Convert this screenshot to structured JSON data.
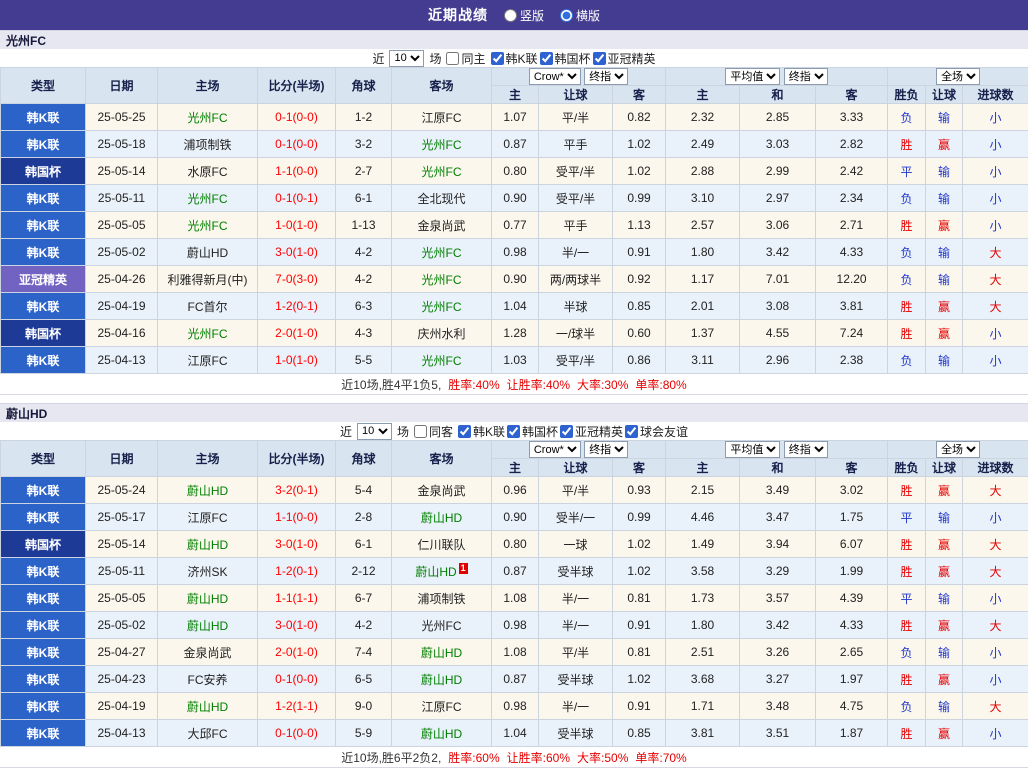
{
  "colors": {
    "red": "#e60000",
    "blue": "#2036cc",
    "green": "#008000",
    "score_red": "#ff0000",
    "topbar_bg": "#443c90",
    "kleague_bg": "#2c63c8",
    "cup_bg": "#1d3a96",
    "acl_bg": "#7263c2"
  },
  "topbar": {
    "title": "近期战绩",
    "layout_options": [
      {
        "label": "竖版",
        "selected": false
      },
      {
        "label": "横版",
        "selected": true
      }
    ]
  },
  "sections": [
    {
      "team": "光州FC",
      "filter": {
        "near_label": "近",
        "count": "10",
        "games_label": "场",
        "same_checkbox": {
          "label": "同主",
          "checked": false
        },
        "league_checkboxes": [
          {
            "label": "韩K联",
            "checked": true
          },
          {
            "label": "韩国杯",
            "checked": true
          },
          {
            "label": "亚冠精英",
            "checked": true
          }
        ]
      },
      "header": {
        "type": "类型",
        "date": "日期",
        "home": "主场",
        "score": "比分(半场)",
        "corner": "角球",
        "away": "客场",
        "odds_select": "Crow*",
        "odds_time_select": "终指",
        "avg_select": "平均值",
        "avg_time_select": "终指",
        "scope_select": "全场",
        "sub": [
          "主",
          "让球",
          "客",
          "主",
          "和",
          "客",
          "胜负",
          "让球",
          "进球数"
        ]
      },
      "rows": [
        {
          "type": "韩K联",
          "type_class": "kleague",
          "date": "25-05-25",
          "home": "光州FC",
          "focus": "home",
          "score": "0-1(0-0)",
          "corner": "1-2",
          "away": "江原FC",
          "o1": "1.07",
          "o2": "平/半",
          "o3": "0.82",
          "a1": "2.32",
          "a2": "2.85",
          "a3": "3.33",
          "r1": "负",
          "r1c": "blue",
          "r2": "输",
          "r2c": "blue",
          "r3": "小",
          "r3c": "blue"
        },
        {
          "type": "韩K联",
          "type_class": "kleague",
          "date": "25-05-18",
          "home": "浦项制铁",
          "focus": "away",
          "score": "0-1(0-0)",
          "corner": "3-2",
          "away": "光州FC",
          "o1": "0.87",
          "o2": "平手",
          "o3": "1.02",
          "a1": "2.49",
          "a2": "3.03",
          "a3": "2.82",
          "r1": "胜",
          "r1c": "red",
          "r2": "赢",
          "r2c": "red",
          "r3": "小",
          "r3c": "blue"
        },
        {
          "type": "韩国杯",
          "type_class": "cup",
          "date": "25-05-14",
          "home": "水原FC",
          "focus": "away",
          "score": "1-1(0-0)",
          "corner": "2-7",
          "away": "光州FC",
          "o1": "0.80",
          "o2": "受平/半",
          "o3": "1.02",
          "a1": "2.88",
          "a2": "2.99",
          "a3": "2.42",
          "r1": "平",
          "r1c": "blue",
          "r2": "输",
          "r2c": "blue",
          "r3": "小",
          "r3c": "blue"
        },
        {
          "type": "韩K联",
          "type_class": "kleague",
          "date": "25-05-11",
          "home": "光州FC",
          "focus": "home",
          "score": "0-1(0-1)",
          "corner": "6-1",
          "away": "全北现代",
          "o1": "0.90",
          "o2": "受平/半",
          "o3": "0.99",
          "a1": "3.10",
          "a2": "2.97",
          "a3": "2.34",
          "r1": "负",
          "r1c": "blue",
          "r2": "输",
          "r2c": "blue",
          "r3": "小",
          "r3c": "blue"
        },
        {
          "type": "韩K联",
          "type_class": "kleague",
          "date": "25-05-05",
          "home": "光州FC",
          "focus": "home",
          "score": "1-0(1-0)",
          "corner": "1-13",
          "away": "金泉尚武",
          "o1": "0.77",
          "o2": "平手",
          "o3": "1.13",
          "a1": "2.57",
          "a2": "3.06",
          "a3": "2.71",
          "r1": "胜",
          "r1c": "red",
          "r2": "赢",
          "r2c": "red",
          "r3": "小",
          "r3c": "blue"
        },
        {
          "type": "韩K联",
          "type_class": "kleague",
          "date": "25-05-02",
          "home": "蔚山HD",
          "focus": "away",
          "score": "3-0(1-0)",
          "corner": "4-2",
          "away": "光州FC",
          "o1": "0.98",
          "o2": "半/一",
          "o3": "0.91",
          "a1": "1.80",
          "a2": "3.42",
          "a3": "4.33",
          "r1": "负",
          "r1c": "blue",
          "r2": "输",
          "r2c": "blue",
          "r3": "大",
          "r3c": "red"
        },
        {
          "type": "亚冠精英",
          "type_class": "acl",
          "date": "25-04-26",
          "home": "利雅得新月(中)",
          "focus": "away",
          "score": "7-0(3-0)",
          "corner": "4-2",
          "away": "光州FC",
          "o1": "0.90",
          "o2": "两/两球半",
          "o3": "0.92",
          "a1": "1.17",
          "a2": "7.01",
          "a3": "12.20",
          "r1": "负",
          "r1c": "blue",
          "r2": "输",
          "r2c": "blue",
          "r3": "大",
          "r3c": "red"
        },
        {
          "type": "韩K联",
          "type_class": "kleague",
          "date": "25-04-19",
          "home": "FC首尔",
          "focus": "away",
          "score": "1-2(0-1)",
          "corner": "6-3",
          "away": "光州FC",
          "o1": "1.04",
          "o2": "半球",
          "o3": "0.85",
          "a1": "2.01",
          "a2": "3.08",
          "a3": "3.81",
          "r1": "胜",
          "r1c": "red",
          "r2": "赢",
          "r2c": "red",
          "r3": "大",
          "r3c": "red"
        },
        {
          "type": "韩国杯",
          "type_class": "cup",
          "date": "25-04-16",
          "home": "光州FC",
          "focus": "home",
          "score": "2-0(1-0)",
          "corner": "4-3",
          "away": "庆州水利",
          "o1": "1.28",
          "o2": "一/球半",
          "o3": "0.60",
          "a1": "1.37",
          "a2": "4.55",
          "a3": "7.24",
          "r1": "胜",
          "r1c": "red",
          "r2": "赢",
          "r2c": "red",
          "r3": "小",
          "r3c": "blue"
        },
        {
          "type": "韩K联",
          "type_class": "kleague",
          "date": "25-04-13",
          "home": "江原FC",
          "focus": "away",
          "score": "1-0(1-0)",
          "corner": "5-5",
          "away": "光州FC",
          "o1": "1.03",
          "o2": "受平/半",
          "o3": "0.86",
          "a1": "3.11",
          "a2": "2.96",
          "a3": "2.38",
          "r1": "负",
          "r1c": "blue",
          "r2": "输",
          "r2c": "blue",
          "r3": "小",
          "r3c": "blue"
        }
      ],
      "summary": {
        "lead": "近10场,胜4平1负5,",
        "rates": [
          "胜率:40%",
          "让胜率:40%",
          "大率:30%",
          "单率:80%"
        ]
      }
    },
    {
      "team": "蔚山HD",
      "filter": {
        "near_label": "近",
        "count": "10",
        "games_label": "场",
        "same_checkbox": {
          "label": "同客",
          "checked": false
        },
        "league_checkboxes": [
          {
            "label": "韩K联",
            "checked": true
          },
          {
            "label": "韩国杯",
            "checked": true
          },
          {
            "label": "亚冠精英",
            "checked": true
          },
          {
            "label": "球会友谊",
            "checked": true
          }
        ]
      },
      "header": {
        "type": "类型",
        "date": "日期",
        "home": "主场",
        "score": "比分(半场)",
        "corner": "角球",
        "away": "客场",
        "odds_select": "Crow*",
        "odds_time_select": "终指",
        "avg_select": "平均值",
        "avg_time_select": "终指",
        "scope_select": "全场",
        "sub": [
          "主",
          "让球",
          "客",
          "主",
          "和",
          "客",
          "胜负",
          "让球",
          "进球数"
        ]
      },
      "rows": [
        {
          "type": "韩K联",
          "type_class": "kleague",
          "date": "25-05-24",
          "home": "蔚山HD",
          "focus": "home",
          "score": "3-2(0-1)",
          "corner": "5-4",
          "away": "金泉尚武",
          "o1": "0.96",
          "o2": "平/半",
          "o3": "0.93",
          "a1": "2.15",
          "a2": "3.49",
          "a3": "3.02",
          "r1": "胜",
          "r1c": "red",
          "r2": "赢",
          "r2c": "red",
          "r3": "大",
          "r3c": "red"
        },
        {
          "type": "韩K联",
          "type_class": "kleague",
          "date": "25-05-17",
          "home": "江原FC",
          "focus": "away",
          "score": "1-1(0-0)",
          "corner": "2-8",
          "away": "蔚山HD",
          "o1": "0.90",
          "o2": "受半/一",
          "o3": "0.99",
          "a1": "4.46",
          "a2": "3.47",
          "a3": "1.75",
          "r1": "平",
          "r1c": "blue",
          "r2": "输",
          "r2c": "blue",
          "r3": "小",
          "r3c": "blue"
        },
        {
          "type": "韩国杯",
          "type_class": "cup",
          "date": "25-05-14",
          "home": "蔚山HD",
          "focus": "home",
          "score": "3-0(1-0)",
          "corner": "6-1",
          "away": "仁川联队",
          "o1": "0.80",
          "o2": "一球",
          "o3": "1.02",
          "a1": "1.49",
          "a2": "3.94",
          "a3": "6.07",
          "r1": "胜",
          "r1c": "red",
          "r2": "赢",
          "r2c": "red",
          "r3": "大",
          "r3c": "red"
        },
        {
          "type": "韩K联",
          "type_class": "kleague",
          "date": "25-05-11",
          "home": "济州SK",
          "focus": "away",
          "score": "1-2(0-1)",
          "corner": "2-12",
          "away": "蔚山HD",
          "away_badge": "1",
          "o1": "0.87",
          "o2": "受半球",
          "o3": "1.02",
          "a1": "3.58",
          "a2": "3.29",
          "a3": "1.99",
          "r1": "胜",
          "r1c": "red",
          "r2": "赢",
          "r2c": "red",
          "r3": "大",
          "r3c": "red"
        },
        {
          "type": "韩K联",
          "type_class": "kleague",
          "date": "25-05-05",
          "home": "蔚山HD",
          "focus": "home",
          "score": "1-1(1-1)",
          "corner": "6-7",
          "away": "浦项制铁",
          "o1": "1.08",
          "o2": "半/一",
          "o3": "0.81",
          "a1": "1.73",
          "a2": "3.57",
          "a3": "4.39",
          "r1": "平",
          "r1c": "blue",
          "r2": "输",
          "r2c": "blue",
          "r3": "小",
          "r3c": "blue"
        },
        {
          "type": "韩K联",
          "type_class": "kleague",
          "date": "25-05-02",
          "home": "蔚山HD",
          "focus": "home",
          "score": "3-0(1-0)",
          "corner": "4-2",
          "away": "光州FC",
          "o1": "0.98",
          "o2": "半/一",
          "o3": "0.91",
          "a1": "1.80",
          "a2": "3.42",
          "a3": "4.33",
          "r1": "胜",
          "r1c": "red",
          "r2": "赢",
          "r2c": "red",
          "r3": "大",
          "r3c": "red"
        },
        {
          "type": "韩K联",
          "type_class": "kleague",
          "date": "25-04-27",
          "home": "金泉尚武",
          "focus": "away",
          "score": "2-0(1-0)",
          "corner": "7-4",
          "away": "蔚山HD",
          "o1": "1.08",
          "o2": "平/半",
          "o3": "0.81",
          "a1": "2.51",
          "a2": "3.26",
          "a3": "2.65",
          "r1": "负",
          "r1c": "blue",
          "r2": "输",
          "r2c": "blue",
          "r3": "小",
          "r3c": "blue"
        },
        {
          "type": "韩K联",
          "type_class": "kleague",
          "date": "25-04-23",
          "home": "FC安养",
          "focus": "away",
          "score": "0-1(0-0)",
          "corner": "6-5",
          "away": "蔚山HD",
          "o1": "0.87",
          "o2": "受半球",
          "o3": "1.02",
          "a1": "3.68",
          "a2": "3.27",
          "a3": "1.97",
          "r1": "胜",
          "r1c": "red",
          "r2": "赢",
          "r2c": "red",
          "r3": "小",
          "r3c": "blue"
        },
        {
          "type": "韩K联",
          "type_class": "kleague",
          "date": "25-04-19",
          "home": "蔚山HD",
          "focus": "home",
          "score": "1-2(1-1)",
          "corner": "9-0",
          "away": "江原FC",
          "o1": "0.98",
          "o2": "半/一",
          "o3": "0.91",
          "a1": "1.71",
          "a2": "3.48",
          "a3": "4.75",
          "r1": "负",
          "r1c": "blue",
          "r2": "输",
          "r2c": "blue",
          "r3": "大",
          "r3c": "red"
        },
        {
          "type": "韩K联",
          "type_class": "kleague",
          "date": "25-04-13",
          "home": "大邱FC",
          "focus": "away",
          "score": "0-1(0-0)",
          "corner": "5-9",
          "away": "蔚山HD",
          "o1": "1.04",
          "o2": "受半球",
          "o3": "0.85",
          "a1": "3.81",
          "a2": "3.51",
          "a3": "1.87",
          "r1": "胜",
          "r1c": "red",
          "r2": "赢",
          "r2c": "red",
          "r3": "小",
          "r3c": "blue"
        }
      ],
      "summary": {
        "lead": "近10场,胜6平2负2,",
        "rates": [
          "胜率:60%",
          "让胜率:60%",
          "大率:50%",
          "单率:70%"
        ]
      }
    }
  ]
}
